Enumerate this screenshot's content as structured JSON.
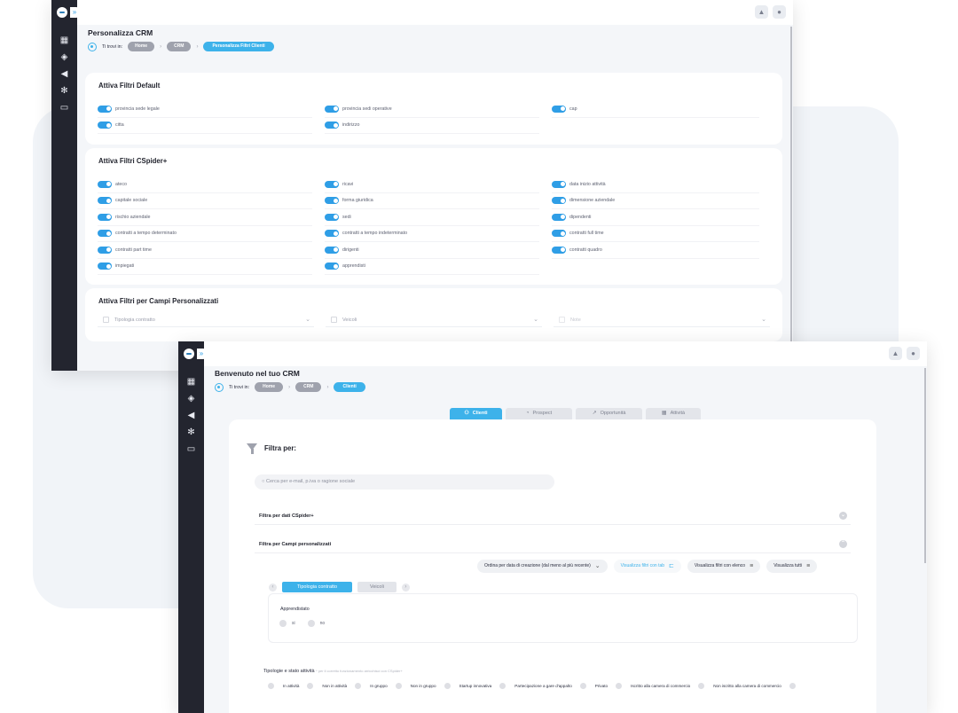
{
  "crm_settings": {
    "page_title": "Personalizza CRM",
    "breadcrumb": {
      "label": "Ti trovi in:",
      "items": [
        "Home",
        "CRM",
        "Personalizza Filtri Clienti"
      ]
    },
    "sections": {
      "default": {
        "title": "Attiva Filtri Default",
        "toggles": [
          "provincia sede legale",
          "provincia sedi operative",
          "cap",
          "citta",
          "indirizzo"
        ]
      },
      "cspider": {
        "title": "Attiva Filtri CSpider+",
        "toggles": [
          "ateco",
          "ricavi",
          "data inizio attività",
          "capitale sociale",
          "forma giuridica",
          "dimensione aziendale",
          "rischio aziendale",
          "sedi",
          "dipendenti",
          "contratti a tempo determinato",
          "contratti a tempo indeterminato",
          "contratti full time",
          "contratti part time",
          "dirigenti",
          "contratti quadro",
          "impiegati",
          "apprendisti"
        ]
      },
      "custom": {
        "title": "Attiva Filtri per Campi Personalizzati",
        "fields": [
          "Tipologia contratto",
          "Veicoli",
          "Note"
        ]
      }
    }
  },
  "crm_home": {
    "page_title": "Benvenuto nel tuo CRM",
    "breadcrumb": {
      "label": "Ti trovi in:",
      "items": [
        "Home",
        "CRM",
        "Clienti"
      ]
    },
    "tabs": [
      "Clienti",
      "Prospect",
      "Opportunità",
      "Attività"
    ],
    "filter_title": "Filtra per:",
    "search_placeholder": "Cerca per e-mail, p.iva o ragione sociale",
    "sections": [
      "Filtra per dati CSpider+",
      "Filtra per Campi personalizzati"
    ],
    "controls": {
      "sort": "Ordina per data di creazione (dal meno al più recente)",
      "view_tabs": "Visualizza filtri con tab",
      "view_list": "Visualizza filtri con elenco",
      "view_all": "Visualizza tutti"
    },
    "sub_tabs": [
      "Tipologia contratto",
      "Veicoli"
    ],
    "inner": {
      "label": "Apprendistato",
      "options": [
        "si",
        "no"
      ]
    },
    "activity": {
      "title": "Tipologie e stato attività",
      "note": "* per il corretto funzionamento arricchisci con CSpider+",
      "chips": [
        "In attività",
        "Non in attività",
        "In gruppo",
        "Non in gruppo",
        "Startup innovativa",
        "Partecipazione a gare d'appalto",
        "Privato",
        "Iscritto alla camera di commercio",
        "Non iscritto alla camera di commercio"
      ]
    }
  },
  "icons": {
    "sidebar": [
      "dashboard-icon",
      "layers-icon",
      "megaphone-icon",
      "spider-icon",
      "monitor-icon"
    ],
    "topbar": [
      "bell-icon",
      "user-icon"
    ]
  },
  "colors": {
    "accent": "#3db2ea",
    "sidebar": "#23252f",
    "toggle": "#2f9ee6"
  }
}
